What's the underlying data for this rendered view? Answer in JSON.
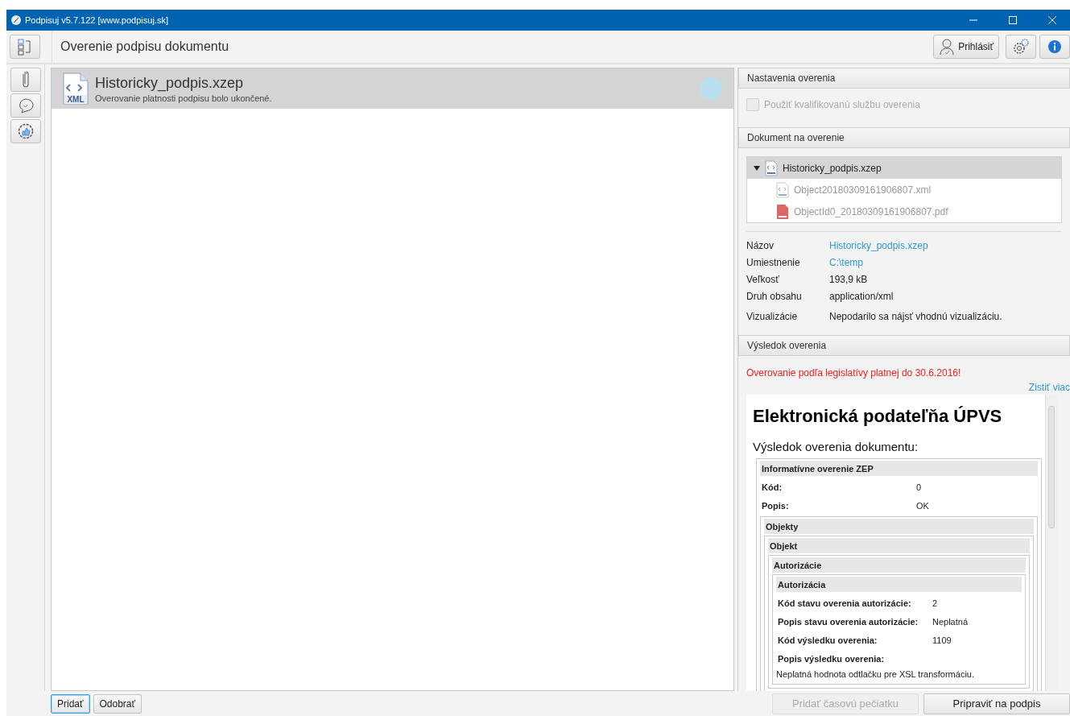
{
  "window": {
    "title": "Podpisuj v5.7.122 [www.podpisuj.sk]"
  },
  "toolbar": {
    "title": "Overenie podpisu dokumentu",
    "login_button": "Prihlásiť"
  },
  "rail": [
    {
      "kind": "attach",
      "selected": false
    },
    {
      "kind": "chat",
      "selected": false
    },
    {
      "kind": "badge",
      "selected": false
    }
  ],
  "documents": [
    {
      "name": "Historicky_podpis.xzep",
      "status": "Overovanie platnosti podpisu bolo ukončené.",
      "selected": true,
      "icon_label": "XML"
    }
  ],
  "settings": {
    "header": "Nastavenia overenia",
    "qualified_service": {
      "label": "Použiť kvalifikovanú službu overenia",
      "checked": false,
      "disabled": true
    }
  },
  "document": {
    "header": "Dokument na overenie",
    "tree": [
      {
        "name": "Historicky_podpis.xzep",
        "kind": "xml",
        "expanded": true,
        "selected": true,
        "children": [
          {
            "name": "Object20180309161906807.xml",
            "kind": "xml",
            "selected": false
          },
          {
            "name": "ObjectId0_20180309161906807.pdf",
            "kind": "pdf",
            "selected": false
          }
        ]
      }
    ],
    "properties": [
      {
        "label": "Názov",
        "value": "Historicky_podpis.xzep",
        "link": true
      },
      {
        "label": "Umiestnenie",
        "value": "C:\\temp",
        "link": true
      },
      {
        "label": "Veľkosť",
        "value": "193,9 kB",
        "link": false
      },
      {
        "label": "Druh obsahu",
        "value": "application/xml",
        "link": false
      },
      {
        "label": "Vizualizácie",
        "value": "Nepodarilo sa nájsť vhodnú vizualizáciu.",
        "link": false
      }
    ]
  },
  "result": {
    "header": "Výsledok overenia",
    "warning": "Overovanie podľa legislatívy platnej do 30.6.2016!",
    "more_link": "Zistiť viac",
    "report": {
      "title": "Elektronická podateľňa ÚPVS",
      "subtitle": "Výsledok overenia dokumentu:",
      "group": {
        "title": "Informatívne overenie ZEP",
        "fields": [
          {
            "label": "Kód:",
            "value": "0"
          },
          {
            "label": "Popis:",
            "value": "OK"
          }
        ],
        "children": [
          {
            "title": "Objekty",
            "children": [
              {
                "title": "Objekt",
                "children": [
                  {
                    "title": "Autorizácie",
                    "children": [
                      {
                        "title": "Autorizácia",
                        "fields": [
                          {
                            "label": "Kód stavu overenia autorizácie:",
                            "value": "2"
                          },
                          {
                            "label": "Popis stavu overenia autorizácie:",
                            "value": "Neplatná"
                          },
                          {
                            "label": "Kód výsledku overenia:",
                            "value": "1109"
                          },
                          {
                            "label": "Popis výsledku overenia:"
                          }
                        ],
                        "note": "Neplatná hodnota odtlačku pre XSL transformáciu."
                      }
                    ]
                  }
                ]
              }
            ]
          }
        ]
      }
    }
  },
  "bottom_left": [
    {
      "label": "Pridať",
      "focused": true
    },
    {
      "label": "Odobrať",
      "focused": false
    }
  ],
  "bottom_right": [
    {
      "label": "Pridať časovú pečiatku",
      "disabled": true
    },
    {
      "label": "Pripraviť na podpis",
      "disabled": false
    }
  ]
}
